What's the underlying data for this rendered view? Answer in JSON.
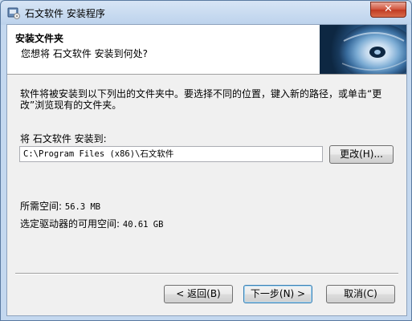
{
  "window": {
    "title": "石文软件 安装程序",
    "close_label": "✕",
    "app_icon": "installer-icon"
  },
  "header": {
    "title": "安装文件夹",
    "subtitle": "您想将 石文软件 安装到何处?",
    "image": "cd-disc-image"
  },
  "body": {
    "description": "软件将被安装到以下列出的文件夹中。要选择不同的位置，键入新的路径，或单击“更改”浏览现有的文件夹。",
    "destination_label": "将 石文软件 安装到:",
    "destination_path": "C:\\Program Files (x86)\\石文软件",
    "browse_label": "更改(H)...",
    "space_required_label": "所需空间:",
    "space_required_value": "56.3 MB",
    "space_available_label": "选定驱动器的可用空间:",
    "space_available_value": "40.61 GB"
  },
  "footer": {
    "back_label": "< 返回(B)",
    "next_label": "下一步(N) >",
    "cancel_label": "取消(C)"
  },
  "colors": {
    "window_frame": "#c4d8ef",
    "close_button": "#d0523a",
    "default_button_border": "#3c7fb1"
  }
}
